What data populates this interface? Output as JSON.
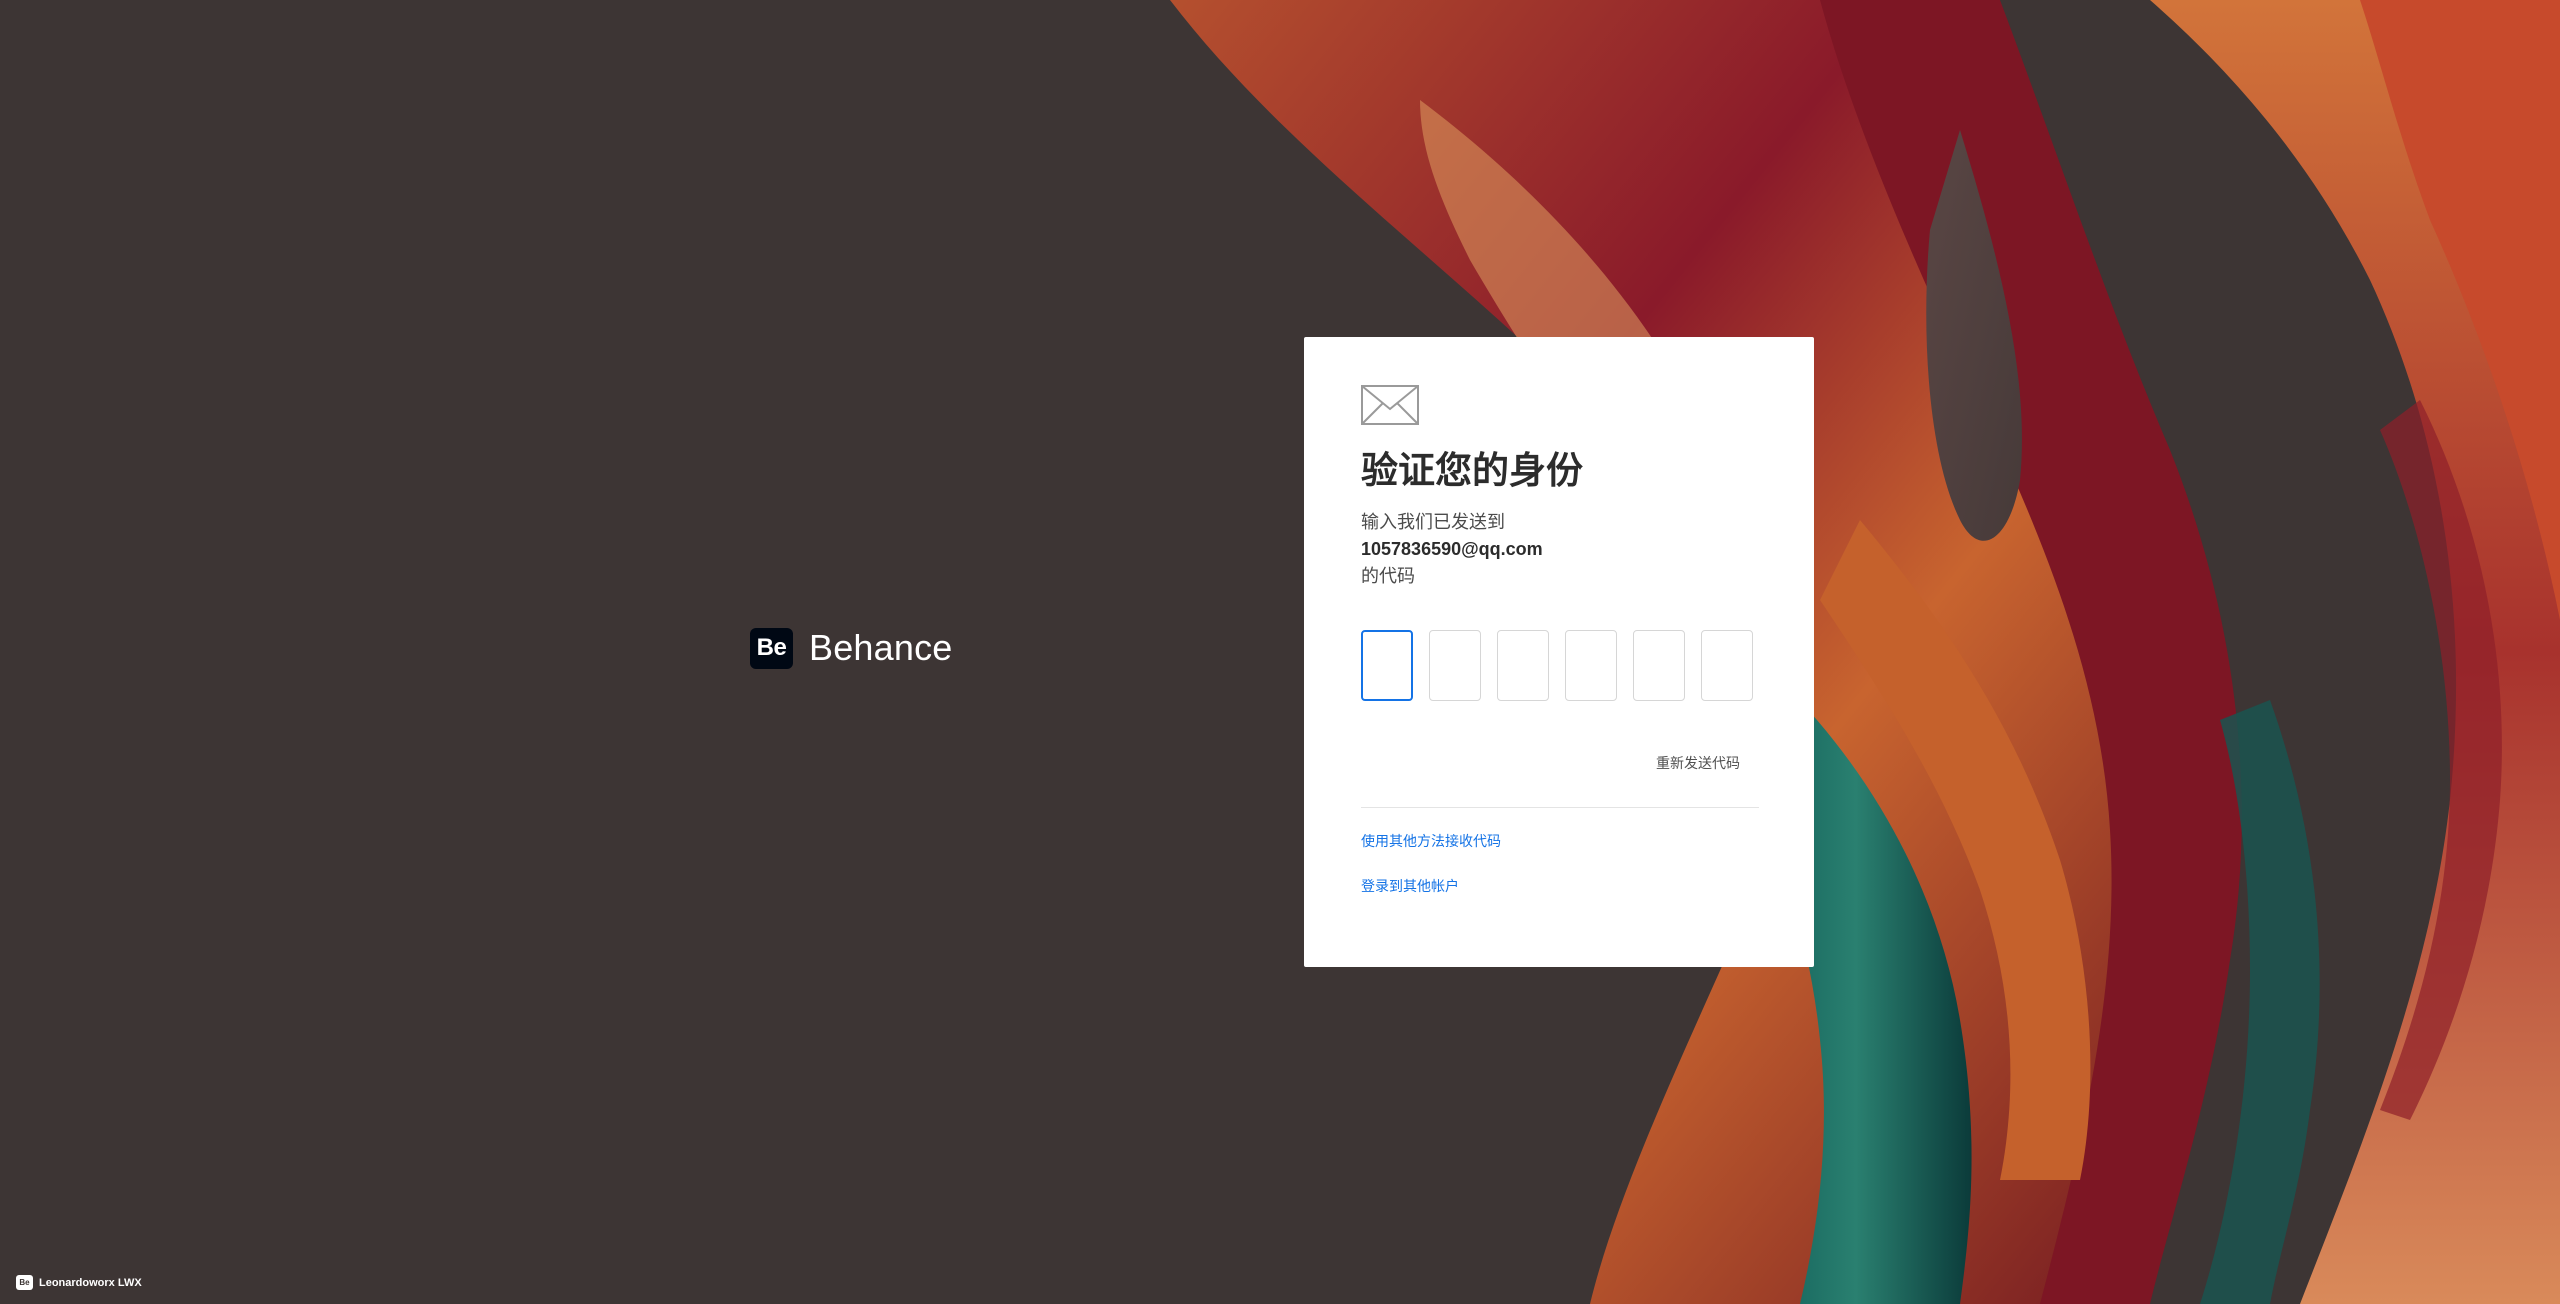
{
  "brand": {
    "logo_text": "Be",
    "name": "Behance"
  },
  "card": {
    "icon": "envelope-icon",
    "title": "验证您的身份",
    "subtitle_line1": "输入我们已发送到",
    "email": "1057836590@qq.com",
    "subtitle_line3": "的代码",
    "code_digits": [
      "",
      "",
      "",
      "",
      "",
      ""
    ],
    "resend_label": "重新发送代码",
    "alt_method_label": "使用其他方法接收代码",
    "other_account_label": "登录到其他帐户"
  },
  "credit": {
    "logo_text": "Be",
    "name": "Leonardoworx LWX"
  },
  "colors": {
    "accent": "#1473e6",
    "background": "#3d3534",
    "brand_logo_bg": "#000814"
  }
}
